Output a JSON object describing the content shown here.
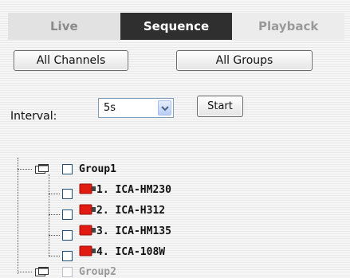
{
  "tabs": [
    {
      "label": "Live"
    },
    {
      "label": "Sequence"
    },
    {
      "label": "Playback"
    }
  ],
  "buttons": {
    "all_channels": "All Channels",
    "all_groups": "All Groups",
    "start": "Start"
  },
  "interval": {
    "label": "Interval:",
    "selected": "5s"
  },
  "tree": {
    "group1": {
      "label": "Group1",
      "cameras": [
        {
          "label": "1. ICA-HM230"
        },
        {
          "label": "2. ICA-H312"
        },
        {
          "label": "3. ICA-HM135"
        },
        {
          "label": "4. ICA-108W"
        }
      ]
    },
    "group2": {
      "label": "Group2"
    }
  },
  "colors": {
    "active_tab": "#2f2f2f",
    "camera_red": "#e21b12",
    "checkbox_border": "#1c5180"
  }
}
